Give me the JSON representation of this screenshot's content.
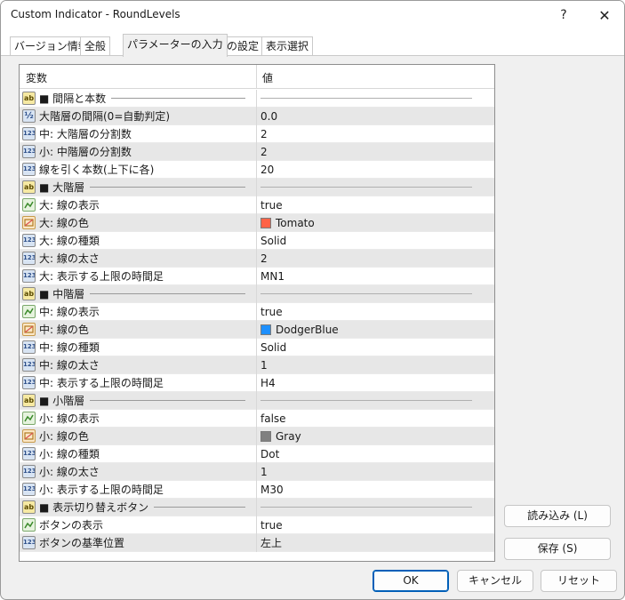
{
  "window": {
    "title": "Custom Indicator - RoundLevels",
    "help": "?",
    "close": "✕"
  },
  "tabs": [
    "バージョン情報",
    "全般",
    "パラメーターの入力",
    "色の設定",
    "表示選択"
  ],
  "active_tab": 2,
  "grid": {
    "col_name": "変数",
    "col_value": "値",
    "rows": [
      {
        "type": "ab",
        "name": "■ 間隔と本数",
        "value": "",
        "section": true
      },
      {
        "type": "frac",
        "name": "大階層の間隔(0=自動判定)",
        "value": "0.0"
      },
      {
        "type": "123",
        "name": "中: 大階層の分割数",
        "value": "2"
      },
      {
        "type": "123",
        "name": "小: 中階層の分割数",
        "value": "2"
      },
      {
        "type": "123",
        "name": "線を引く本数(上下に各)",
        "value": "20"
      },
      {
        "type": "ab",
        "name": "■ 大階層",
        "value": "",
        "section": true
      },
      {
        "type": "bool",
        "name": "大: 線の表示",
        "value": "true"
      },
      {
        "type": "color",
        "name": "大: 線の色",
        "value": "Tomato",
        "color": "#ff6347"
      },
      {
        "type": "123",
        "name": "大: 線の種類",
        "value": "Solid"
      },
      {
        "type": "123",
        "name": "大: 線の太さ",
        "value": "2"
      },
      {
        "type": "123",
        "name": "大: 表示する上限の時間足",
        "value": "MN1"
      },
      {
        "type": "ab",
        "name": "■ 中階層",
        "value": "",
        "section": true
      },
      {
        "type": "bool",
        "name": "中: 線の表示",
        "value": "true"
      },
      {
        "type": "color",
        "name": "中: 線の色",
        "value": "DodgerBlue",
        "color": "#1e90ff"
      },
      {
        "type": "123",
        "name": "中: 線の種類",
        "value": "Solid"
      },
      {
        "type": "123",
        "name": "中: 線の太さ",
        "value": "1"
      },
      {
        "type": "123",
        "name": "中: 表示する上限の時間足",
        "value": "H4"
      },
      {
        "type": "ab",
        "name": "■ 小階層",
        "value": "",
        "section": true
      },
      {
        "type": "bool",
        "name": "小: 線の表示",
        "value": "false"
      },
      {
        "type": "color",
        "name": "小: 線の色",
        "value": "Gray",
        "color": "#808080"
      },
      {
        "type": "123",
        "name": "小: 線の種類",
        "value": "Dot"
      },
      {
        "type": "123",
        "name": "小: 線の太さ",
        "value": "1"
      },
      {
        "type": "123",
        "name": "小: 表示する上限の時間足",
        "value": "M30"
      },
      {
        "type": "ab",
        "name": "■ 表示切り替えボタン",
        "value": "",
        "section": true
      },
      {
        "type": "bool",
        "name": "ボタンの表示",
        "value": "true"
      },
      {
        "type": "123",
        "name": "ボタンの基準位置",
        "value": "左上"
      }
    ]
  },
  "buttons": {
    "load": "読み込み (L)",
    "save": "保存 (S)",
    "ok": "OK",
    "cancel": "キャンセル",
    "reset": "リセット"
  }
}
